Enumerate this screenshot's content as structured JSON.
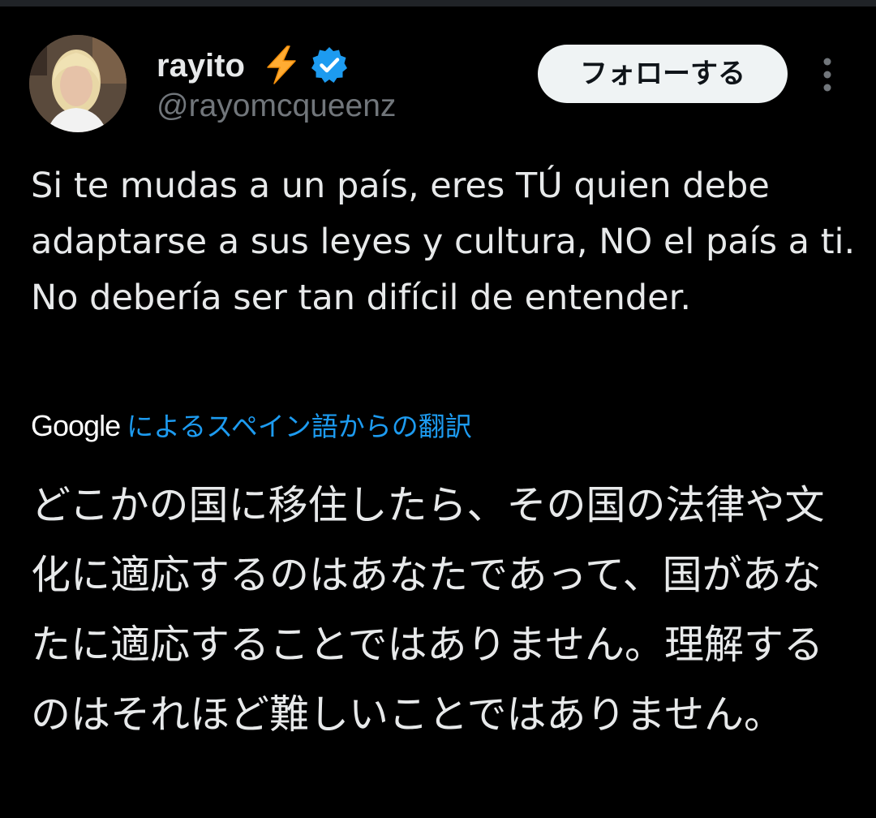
{
  "author": {
    "display_name": "rayito",
    "handle": "@rayomcqueenz",
    "verified": true,
    "name_emoji": "lightning-bolt"
  },
  "actions": {
    "follow_label": "フォローする",
    "more_icon": "more-vertical-icon"
  },
  "tweet": {
    "text": "Si te mudas a un país, eres TÚ quien debe adaptarse a sus leyes y cultura, NO el país a ti. No debería ser tan difícil de entender."
  },
  "translation": {
    "provider": "Google",
    "attribution": "によるスペイン語からの翻訳",
    "text": "どこかの国に移住したら、その国の法律や文化に適応するのはあなたであって、国があなたに適応することではありません。理解するのはそれほど難しいことではありません。"
  },
  "colors": {
    "background": "#000000",
    "text_primary": "#e7e9ea",
    "text_secondary": "#71767b",
    "link": "#1d9bf0",
    "verified_badge": "#1d9bf0",
    "button_bg": "#eff3f4",
    "button_text": "#0f1419"
  }
}
